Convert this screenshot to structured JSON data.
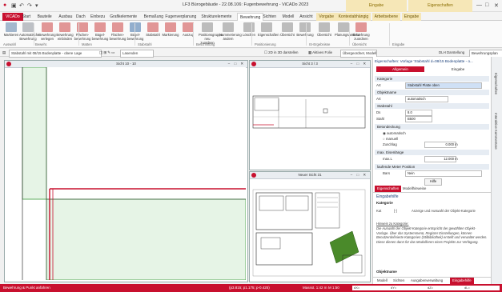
{
  "titlebar": {
    "title": "LF3 Bürogebäude - 22.08.106: Fugenbewehrung - ViCADo 2023",
    "context_group_1": "Eingabe",
    "context_group_2": "Eigenschaften",
    "quick_icons": [
      "save-icon",
      "undo-icon",
      "redo-icon",
      "dropdown-icon"
    ],
    "window_controls": [
      "—",
      "□",
      "✕"
    ]
  },
  "tabs": [
    "ViCADo",
    "Start",
    "Bauteile",
    "Ausbau",
    "Dach",
    "Einbezu",
    "Grafikelemente",
    "Bemaßung",
    "Fugenverplanung",
    "Strukturelemente",
    "Bewehrung",
    "Sichten",
    "Modell",
    "Ansicht",
    "Vorgabe",
    "Kontextabhängig",
    "Arbeitsebene",
    "Eingabe"
  ],
  "active_tab_index": 10,
  "ribbon": {
    "buttons": [
      {
        "label": "Markieren",
        "color": "#5b7fa8"
      },
      {
        "label": "Automatische Bewehrung",
        "color": "#8a8f99"
      },
      {
        "label": "Bewehrung verlegen",
        "color": "#c44"
      },
      {
        "label": "Bewehrung einbinden",
        "color": "#c44"
      },
      {
        "label": "Flächen-bewehrung",
        "color": "#c44"
      },
      {
        "label": "Bügel-bewehrung",
        "color": "#c44"
      },
      {
        "label": "Flächen-bewehrung",
        "color": "#c44"
      },
      {
        "label": "Bügel-bewehrung",
        "color": "#3d6fa8"
      },
      {
        "label": "Stabstahl",
        "color": "#c44"
      },
      {
        "label": "Markierung",
        "color": "#c44"
      },
      {
        "label": "Auszug",
        "color": "#c44"
      },
      {
        "label": "Positionsgruppe neu zuordnen",
        "color": "#888"
      },
      {
        "label": "Nummerierung ändern",
        "color": "#888"
      },
      {
        "label": "Löschen",
        "color": "#888"
      },
      {
        "label": "Eigenschaften",
        "color": "#888"
      },
      {
        "label": "Übersicht",
        "color": "#888"
      },
      {
        "label": "Bewehrung",
        "color": "#888"
      },
      {
        "label": "Übersicht",
        "color": "#888"
      },
      {
        "label": "Planungsansicht",
        "color": "#888"
      },
      {
        "label": "Bewehrung zuordnen",
        "color": "#c44"
      }
    ],
    "groups": [
      "Auswahl",
      "Bewehr.",
      "Matten",
      "Stabstahl",
      "Beschriftung",
      "Positionierung",
      "IS-Ergebnisse",
      "Übersicht",
      "Eingabe"
    ]
  },
  "toolbar2": {
    "view_combo": "Stabstahl mit 08/15 Bodenplatte - obere Lage",
    "layer_combo": "Lasenden",
    "snap_label": "2D in 3D darstellen",
    "fill_label": "Aktives Folie",
    "view_label": "Übergeordnet, Modelle",
    "right_label": "DLH Darstellung",
    "right_combo": "Bewehrungsplan"
  },
  "windows": {
    "main": "Sicht 10 - 10",
    "top_right": "Sicht 3 / 3",
    "bottom_right": "Neuer Sicht 31"
  },
  "panel": {
    "title": "Eigenschaften: Vorlage 'Stabstahl d=08/15 Bodenplatte - o...",
    "tabs": [
      "Allgemein",
      "Eingabe"
    ],
    "sections": {
      "kategorie": "Kategorie",
      "art_label": "Art",
      "art_value": "Stabstahl Platte oben",
      "objektname": "Objektname",
      "art2_label": "Art",
      "art2_value": "automatisch",
      "stabstahl": "Stabstahl",
      "ds_label": "Ds",
      "ds_value": "8.0",
      "stahl_label": "Stahl",
      "stahl_value": "B500",
      "betondeckung": "Betondeckung",
      "radio1": "automatisch",
      "radio2": "manuell",
      "zuschlag_label": "Zuschlag",
      "zuschlag_value": "0.000",
      "zuschlag_unit": "m",
      "max_eisenlaenge": "max. Eisenlänge",
      "max_label": "max.L",
      "max_value": "12.000",
      "max_unit": "m",
      "laufende": "laufende Meter Position",
      "bars_label": "Bars",
      "bars_value": "Nein",
      "help_btn": "Hilfe"
    },
    "lower_tabs": [
      "Eigenschaften",
      "Modellhinweise"
    ],
    "eingabehilfe": "Eingabehilfe",
    "kategorie2": "Kategorie",
    "help_row_label": "Kat",
    "help_row_key": "[-]",
    "help_row_text": "Anzeige und Auswahl der Objekt-Kategorie",
    "help_heading": "Hinweis zu Kategorie:",
    "help_body": "Die Auswahl der Objekt-Kategorie entspricht der gewählten Objekt-Vorlage. Über das Systemmenü, Register Einstellungen, können Benutzerdefinierte Kategorien (Stilbibliothek) erstellt und verwaltet werden. Diese dienen dann für das Modellieren eines Projekts zur Verfügung.",
    "objektname2": "Objektname",
    "bottom_tabs": [
      "Modell",
      "Sichten",
      "Ausgabenverwaltung",
      "Eingabehilfe"
    ]
  },
  "rightbar": [
    "Eigenschaften",
    "Interaktive Kommentare"
  ],
  "statusbar": {
    "left": "Bewehrung & Punkt anfahren",
    "coords": "(p3.815; p1.175; p-0.425)",
    "scale_label": "Massst. 1:42 m",
    "zoom": "M 1:50",
    "fields": [
      "dX=",
      "dY=",
      "dZ=",
      "dL="
    ]
  }
}
